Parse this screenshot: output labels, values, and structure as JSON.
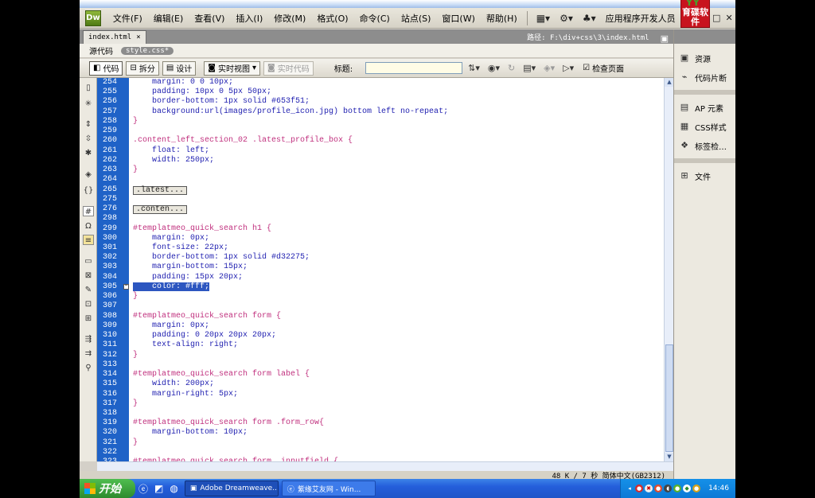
{
  "menu": [
    "文件(F)",
    "编辑(E)",
    "查看(V)",
    "插入(I)",
    "修改(M)",
    "格式(O)",
    "命令(C)",
    "站点(S)",
    "窗口(W)",
    "帮助(H)"
  ],
  "app_logo": "Dw",
  "workspace_label": "应用程序开发人员",
  "brand": {
    "top": "YY",
    "text": "育碟软件"
  },
  "document": {
    "tab": "index.html",
    "close": "×",
    "path": "路径: F:\\div+css\\3\\index.html"
  },
  "related": {
    "source": "源代码",
    "file": "style.css*"
  },
  "toolbar": {
    "code": "代码",
    "split": "拆分",
    "design": "设计",
    "live_view": "实时视图",
    "live_code": "实时代码",
    "title_label": "标题:",
    "title_value": "",
    "check_page": "检查页面"
  },
  "line_numbers": [
    "254",
    "255",
    "256",
    "257",
    "258",
    "259",
    "260",
    "261",
    "262",
    "263",
    "264",
    "265",
    "275",
    "276",
    "298",
    "299",
    "300",
    "301",
    "302",
    "303",
    "304",
    "305",
    "306",
    "307",
    "308",
    "309",
    "310",
    "311",
    "312",
    "313",
    "314",
    "315",
    "316",
    "317",
    "318",
    "319",
    "320",
    "321",
    "322",
    "323"
  ],
  "code_lines": [
    "    margin: 0 0 10px;",
    "    padding: 10px 0 5px 50px;",
    "    border-bottom: 1px solid #653f51;",
    "    background:url(images/profile_icon.jpg) bottom left no-repeat;",
    "}",
    "",
    ".content_left_section_02 .latest_profile_box {",
    "    float: left;",
    "    width: 250px;",
    "}",
    "",
    ".latest...",
    "",
    ".conten...",
    "",
    "#templatmeo_quick_search h1 {",
    "    margin: 0px;",
    "    font-size: 22px;",
    "    border-bottom: 1px solid #d32275;",
    "    margin-bottom: 15px;",
    "    padding: 15px 20px;",
    "    color: #fff;",
    "}",
    "",
    "#templatmeo_quick_search form {",
    "    margin: 0px;",
    "    padding: 0 20px 20px 20px;",
    "    text-align: right;",
    "}",
    "",
    "#templatmeo_quick_search form label {",
    "    width: 200px;",
    "    margin-right: 5px;",
    "}",
    "",
    "#templatmeo_quick_search form .form_row{",
    "    margin-bottom: 10px;",
    "}",
    "",
    "#templatmeo_quick_search form .inputfield {"
  ],
  "right_panel": [
    "资源",
    "代码片断",
    "AP 元素",
    "CSS样式",
    "标签检…",
    "文件"
  ],
  "status": "48 K / 7 秒  简体中文(GB2312)",
  "taskbar": {
    "start": "开始",
    "tasks": [
      "Adobe Dreamweave...",
      "紫缘艾友网 - Win..."
    ],
    "time": "14:46"
  },
  "colors": {
    "gutter": "#1f62c7",
    "selection": "#2c56c0",
    "selector": "#c0307e",
    "property": "#1f1fb0",
    "taskbar": "#245edb"
  }
}
